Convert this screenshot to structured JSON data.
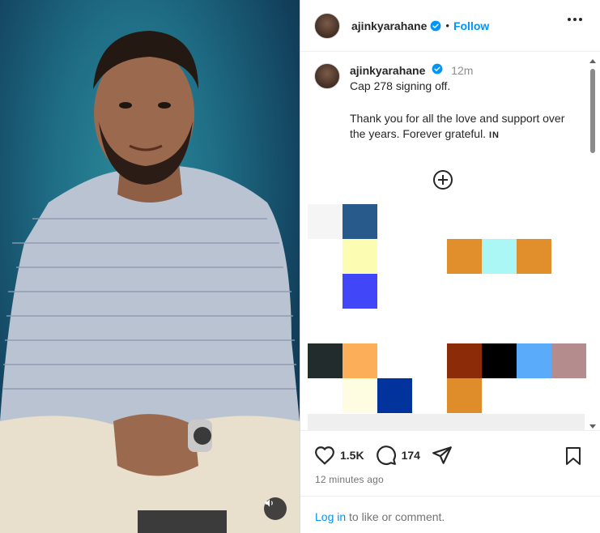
{
  "post": {
    "username": "ajinkyarahane",
    "follow_label": "Follow",
    "separator": "•",
    "time": "12m",
    "caption_line1": "Cap 278 signing off.",
    "caption_line2": "Thank you for all the love and support over the years. Forever grateful.",
    "caption_flag": "IN"
  },
  "actions": {
    "likes": "1.5K",
    "comments": "174",
    "time_ago": "12 minutes ago"
  },
  "login": {
    "link": "Log in",
    "rest": " to like or comment."
  },
  "colors": {
    "accent": "#0095f6",
    "verified": "#0095f6",
    "mosaic": [
      "#f5f5f5",
      "#285b8b",
      "#fdfcb3",
      "#e18e2c",
      "#abf7f5",
      "#e18e2c",
      "#4147f8",
      "#232c2d",
      "#fcae59",
      "#8b2b08",
      "#000000",
      "#5aabf9",
      "#b48c8e",
      "#fffde1",
      "#02329b",
      "#df8c2b"
    ]
  },
  "icons": {
    "heart": "heart-icon",
    "comment": "comment-icon",
    "share": "share-icon",
    "bookmark": "bookmark-icon",
    "more": "more-icon",
    "add": "plus-circle-icon",
    "sound": "speaker-icon",
    "verified": "verified-badge-icon"
  }
}
